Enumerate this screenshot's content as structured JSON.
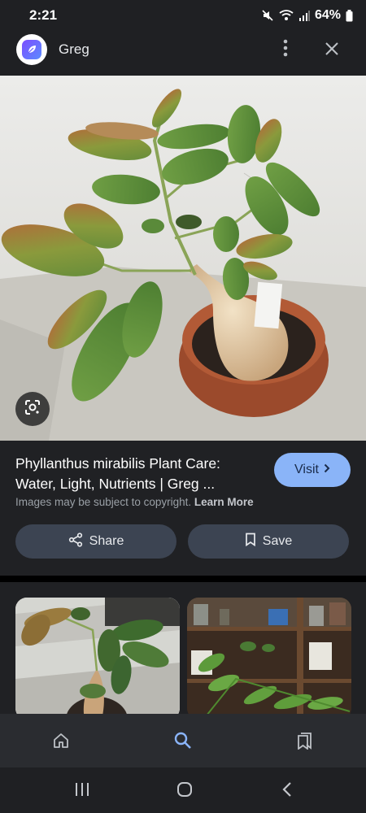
{
  "status_bar": {
    "time": "2:21",
    "battery": "64%"
  },
  "header": {
    "title": "Greg",
    "logo_icon": "greg-leaf-icon",
    "more_icon": "more-vert-icon",
    "close_icon": "close-icon"
  },
  "hero": {
    "subject": "plant-photo",
    "lens_icon": "lens-icon"
  },
  "result": {
    "title": "Phyllanthus mirabilis Plant Care: Water, Light, Nutrients | Greg ...",
    "visit_label": "Visit",
    "copyright_text": "Images may be subject to copyright.",
    "learn_more": "Learn More",
    "share_label": "Share",
    "save_label": "Save"
  },
  "related": {
    "items": [
      {
        "icon": "plant-thumbnail"
      },
      {
        "icon": "plant-shelf-thumbnail"
      }
    ]
  },
  "bottom_nav": {
    "items": [
      {
        "icon": "home-icon"
      },
      {
        "icon": "search-icon",
        "active": true
      },
      {
        "icon": "saved-icon"
      }
    ]
  },
  "colors": {
    "accent": "#8ab4f8",
    "surface": "#202124",
    "button": "#3c4452"
  }
}
